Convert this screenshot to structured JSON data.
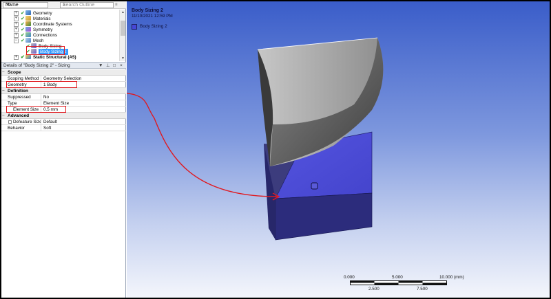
{
  "outline": {
    "name_combo": "Name",
    "search_placeholder": "Search Outline",
    "tree": [
      {
        "label": "Geometry",
        "icon": "geometry-icon",
        "expand": "+"
      },
      {
        "label": "Materials",
        "icon": "materials-icon",
        "expand": "+"
      },
      {
        "label": "Coordinate Systems",
        "icon": "coordinate-systems-icon",
        "expand": "+"
      },
      {
        "label": "Symmetry",
        "icon": "symmetry-icon",
        "expand": "+"
      },
      {
        "label": "Connections",
        "icon": "connections-icon",
        "expand": "+"
      },
      {
        "label": "Mesh",
        "icon": "mesh-icon",
        "expand": "−"
      },
      {
        "label": "Body Sizing",
        "icon": "body-sizing-icon"
      },
      {
        "label": "Body Sizing 2",
        "icon": "body-sizing-icon",
        "selected": true
      },
      {
        "label": "Static Structural (A5)",
        "icon": "static-structural-icon",
        "expand": "+"
      }
    ]
  },
  "details": {
    "title": "Details of \"Body Sizing 2\" - Sizing",
    "pin": "▼ ⊥ □ ×",
    "sections": {
      "scope": "Scope",
      "definition": "Definition",
      "advanced": "Advanced"
    },
    "rows": {
      "scoping_method": {
        "key": "Scoping Method",
        "value": "Geometry Selection"
      },
      "geometry": {
        "key": "Geometry",
        "value": "1 Body"
      },
      "suppressed": {
        "key": "Suppressed",
        "value": "No"
      },
      "type": {
        "key": "Type",
        "value": "Element Size"
      },
      "element_size": {
        "key": "Element Size",
        "value": "0.5 mm"
      },
      "defeature_size": {
        "key": "Defeature Size",
        "value": "Default"
      },
      "behavior": {
        "key": "Behavior",
        "value": "Soft"
      }
    }
  },
  "viewport": {
    "title": "Body Sizing 2",
    "date": "11/10/2021 12:59 PM",
    "legend_label": "Body Sizing 2",
    "legend_color": "#4747d6",
    "scale": {
      "top": [
        "0.000",
        "5.000",
        "10.000 (mm)"
      ],
      "bottom": [
        "2.500",
        "7.500"
      ]
    }
  },
  "colors": {
    "highlight": "#e0191f",
    "selected_body": "#4747d6",
    "selection": "#3399ff"
  }
}
